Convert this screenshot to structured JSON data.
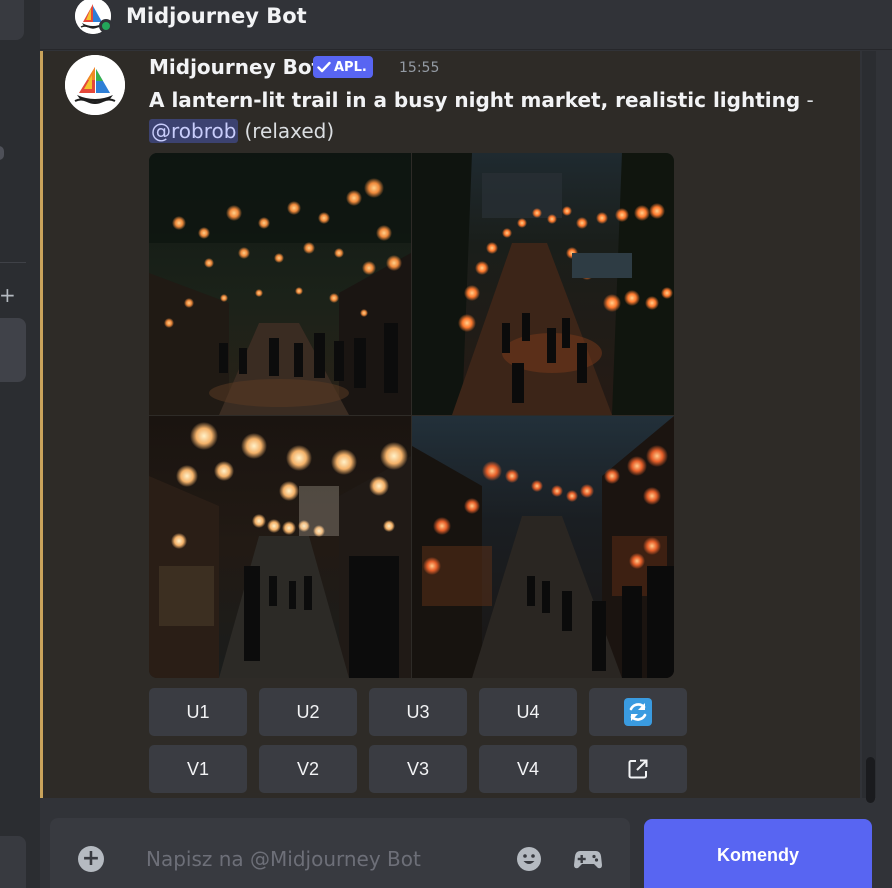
{
  "header": {
    "title": "Midjourney Bot",
    "status": "online"
  },
  "message": {
    "author": "Midjourney Bot",
    "app_badge": "APL.",
    "timestamp": "15:55",
    "prompt": "A lantern-lit trail in a busy night market, realistic lighting",
    "dash": " -",
    "mention": "@robrob",
    "mode": "(relaxed)",
    "accent_color": "#c9a35b"
  },
  "image_grid": {
    "tiles": [
      {
        "name": "image-1"
      },
      {
        "name": "image-2"
      },
      {
        "name": "image-3"
      },
      {
        "name": "image-4"
      }
    ]
  },
  "buttons": {
    "row1": [
      "U1",
      "U2",
      "U3",
      "U4"
    ],
    "reroll_icon": "refresh-icon",
    "row2": [
      "V1",
      "V2",
      "V3",
      "V4"
    ],
    "open_icon": "external-link-icon"
  },
  "composer": {
    "placeholder": "Napisz na @Midjourney Bot",
    "commands_label": "Komendy",
    "commands_color": "#5865f2"
  }
}
